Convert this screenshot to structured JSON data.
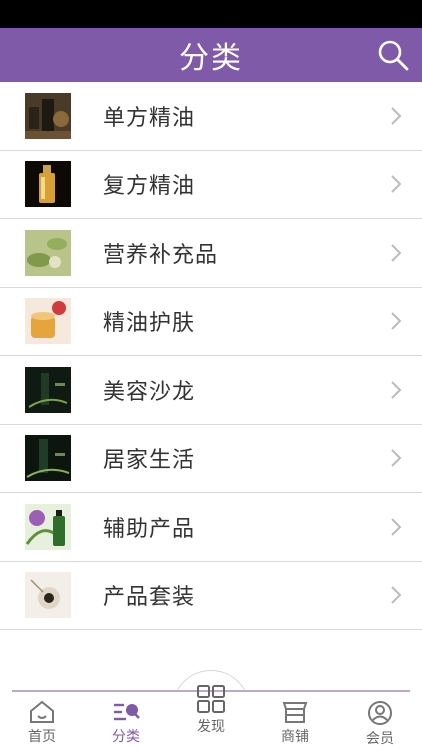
{
  "header": {
    "title": "分类",
    "search_icon": "search-icon"
  },
  "categories": [
    {
      "label": "单方精油",
      "thumb": "essential-oil-bottles"
    },
    {
      "label": "复方精油",
      "thumb": "golden-oil-bottle"
    },
    {
      "label": "营养补充品",
      "thumb": "herbal-plants"
    },
    {
      "label": "精油护肤",
      "thumb": "oil-jar-roses"
    },
    {
      "label": "美容沙龙",
      "thumb": "dark-bottle-green"
    },
    {
      "label": "居家生活",
      "thumb": "dark-bottle-leaves"
    },
    {
      "label": "辅助产品",
      "thumb": "green-bottle-flower"
    },
    {
      "label": "产品套装",
      "thumb": "dried-flower"
    }
  ],
  "tabbar": {
    "tabs": [
      {
        "label": "首页",
        "icon": "home-icon"
      },
      {
        "label": "分类",
        "icon": "category-icon",
        "active": true
      },
      {
        "label": "发现",
        "icon": "grid-icon"
      },
      {
        "label": "商铺",
        "icon": "shop-icon"
      },
      {
        "label": "会员",
        "icon": "user-icon"
      }
    ]
  },
  "colors": {
    "accent": "#7e5aa8",
    "divider": "#d9d9d9"
  }
}
